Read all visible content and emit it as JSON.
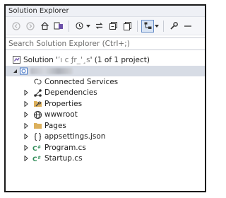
{
  "window": {
    "title": "Solution Explorer"
  },
  "toolbar": {
    "buttons": [
      "back-icon",
      "forward-icon",
      "home-icon",
      "switch-views-icon",
      "pending-changes-icon",
      "sync-icon",
      "collapse-all-icon",
      "show-all-files-icon",
      "preview-selected-icon",
      "properties-icon",
      "pin-icon"
    ]
  },
  "search": {
    "placeholder": "Search Solution Explorer (Ctrl+;)"
  },
  "solution": {
    "prefix": "Solution '",
    "garbled": "’ı c ƒr_'¸s",
    "suffix": "' (1 of 1 project)"
  },
  "project": {
    "name": ""
  },
  "items": [
    {
      "label": "Connected Services",
      "icon": "connected-services-icon",
      "expandable": false
    },
    {
      "label": "Dependencies",
      "icon": "dependencies-icon",
      "expandable": true
    },
    {
      "label": "Properties",
      "icon": "properties-folder-icon",
      "expandable": true
    },
    {
      "label": "wwwroot",
      "icon": "globe-icon",
      "expandable": true
    },
    {
      "label": "Pages",
      "icon": "folder-icon",
      "expandable": true
    },
    {
      "label": "appsettings.json",
      "icon": "json-file-icon",
      "expandable": true
    },
    {
      "label": "Program.cs",
      "icon": "csharp-file-icon",
      "expandable": true
    },
    {
      "label": "Startup.cs",
      "icon": "csharp-file-icon",
      "expandable": true
    }
  ],
  "colors": {
    "accent": "#6a8fc8",
    "selection": "#d7dce5",
    "csharp": "#2e8b57",
    "folder": "#dcb05c"
  }
}
